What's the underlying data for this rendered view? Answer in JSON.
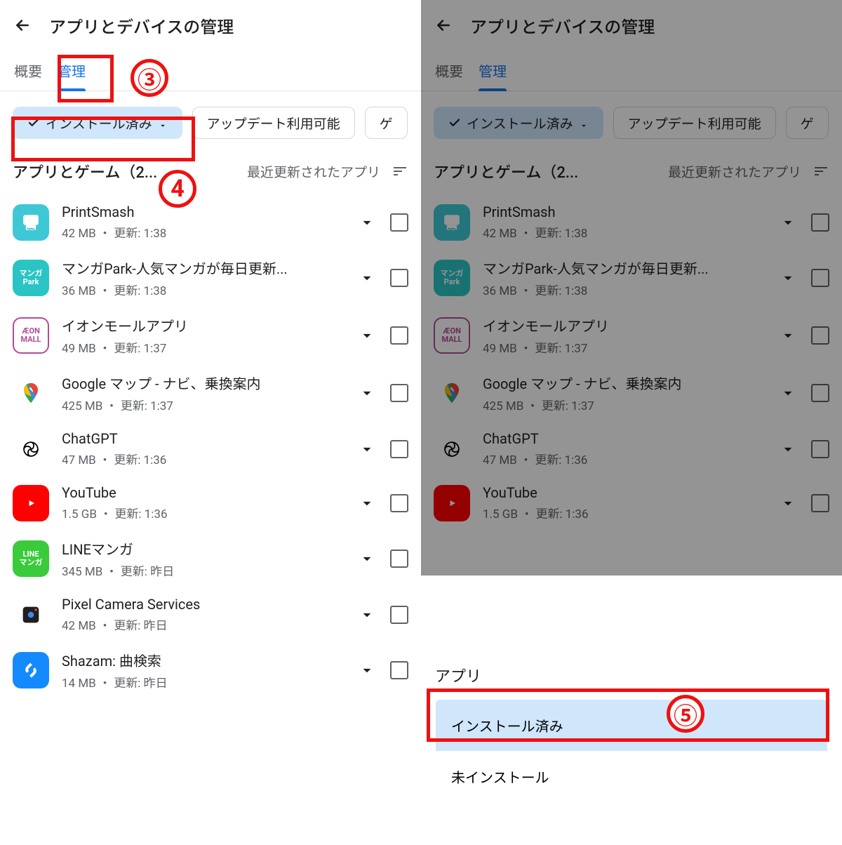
{
  "header": {
    "title": "アプリとデバイスの管理"
  },
  "tabs": {
    "overview": "概要",
    "manage": "管理"
  },
  "filters": {
    "installed": "インストール済み",
    "updates": "アップデート利用可能",
    "games": "ゲ"
  },
  "section": {
    "title": "アプリとゲーム（2...",
    "sort": "最近更新されたアプリ"
  },
  "apps": [
    {
      "name": "PrintSmash",
      "meta": "42 MB  ・ 更新: 1:38",
      "icon": "printsmash"
    },
    {
      "name": "マンガPark-人気マンガが毎日更新...",
      "meta": "36 MB  ・ 更新: 1:38",
      "icon": "mangapark"
    },
    {
      "name": "イオンモールアプリ",
      "meta": "49 MB  ・ 更新: 1:37",
      "icon": "aeon"
    },
    {
      "name": "Google マップ - ナビ、乗換案内",
      "meta": "425 MB  ・ 更新: 1:37",
      "icon": "gmaps"
    },
    {
      "name": "ChatGPT",
      "meta": "47 MB  ・ 更新: 1:36",
      "icon": "chatgpt"
    },
    {
      "name": "YouTube",
      "meta": "1.5 GB  ・ 更新: 1:36",
      "icon": "youtube"
    },
    {
      "name": "LINEマンガ",
      "meta": "345 MB  ・ 更新: 昨日",
      "icon": "linemanga"
    },
    {
      "name": "Pixel Camera Services",
      "meta": "42 MB  ・ 更新: 昨日",
      "icon": "pixelcam"
    },
    {
      "name": "Shazam: 曲検索",
      "meta": "14 MB  ・ 更新: 昨日",
      "icon": "shazam"
    }
  ],
  "right_visible_apps": 6,
  "sheet": {
    "title": "アプリ",
    "opt_installed": "インストール済み",
    "opt_not_installed": "未インストール"
  },
  "annotations": {
    "n3": "③",
    "n4": "4",
    "n5": "⑤"
  },
  "icon_styles": {
    "printsmash": {
      "bg": "#3ec8d6",
      "label": ""
    },
    "mangapark": {
      "bg": "#2bc4c4",
      "label": "マンガ\nPark"
    },
    "aeon": {
      "bg": "#ffffff",
      "label": "ÆON\nMALL",
      "border": "#b44a9a",
      "color": "#b44a9a"
    },
    "gmaps": {
      "bg": "#ffffff",
      "label": ""
    },
    "chatgpt": {
      "bg": "#ffffff",
      "label": ""
    },
    "youtube": {
      "bg": "#ff0000",
      "label": ""
    },
    "linemanga": {
      "bg": "#3acb3a",
      "label": "LINE\nマンガ"
    },
    "pixelcam": {
      "bg": "#ffffff",
      "label": ""
    },
    "shazam": {
      "bg": "#148aff",
      "label": ""
    }
  }
}
